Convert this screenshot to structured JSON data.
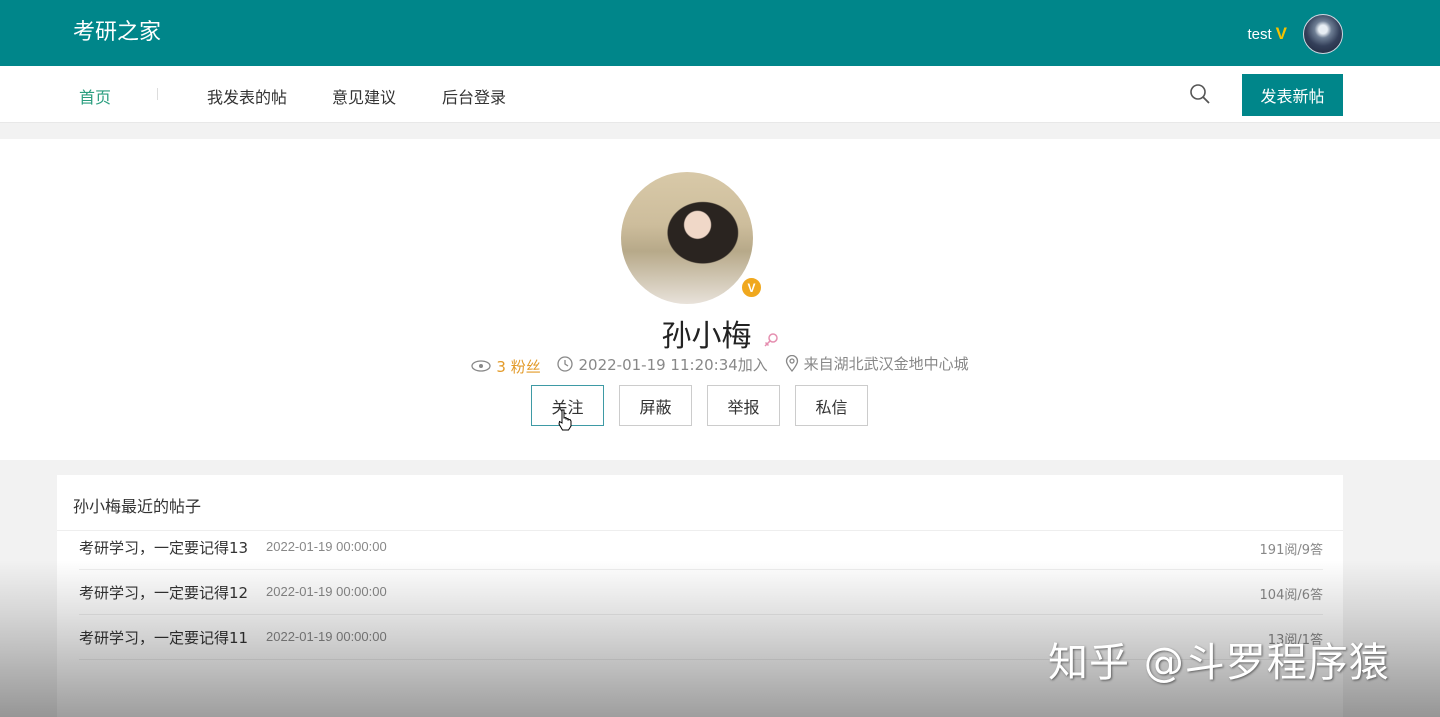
{
  "header": {
    "brand": "考研之家",
    "username": "test",
    "vip_mark": "V",
    "accent_color": "#00868a"
  },
  "nav": {
    "items": [
      {
        "label": "首页",
        "active": true
      },
      {
        "label": "我发表的帖",
        "active": false
      },
      {
        "label": "意见建议",
        "active": false
      },
      {
        "label": "后台登录",
        "active": false
      }
    ],
    "search_icon": "search-icon",
    "new_post_label": "发表新帖"
  },
  "profile": {
    "name": "孙小梅",
    "verified_badge": "V",
    "gender_icon": "female-icon",
    "fans_text": "3 粉丝",
    "joined_text": "2022-01-19 11:20:34加入",
    "location_text": "来自湖北武汉金地中心城",
    "actions": [
      "关注",
      "屏蔽",
      "举报",
      "私信"
    ]
  },
  "posts": {
    "title": "孙小梅最近的帖子",
    "rows": [
      {
        "title": "考研学习，一定要记得13",
        "date": "2022-01-19 00:00:00",
        "stats": "191阅/9答"
      },
      {
        "title": "考研学习，一定要记得12",
        "date": "2022-01-19 00:00:00",
        "stats": "104阅/6答"
      },
      {
        "title": "考研学习，一定要记得11",
        "date": "2022-01-19 00:00:00",
        "stats": "13阅/1答"
      }
    ]
  },
  "watermark": "知乎 @斗罗程序猿"
}
